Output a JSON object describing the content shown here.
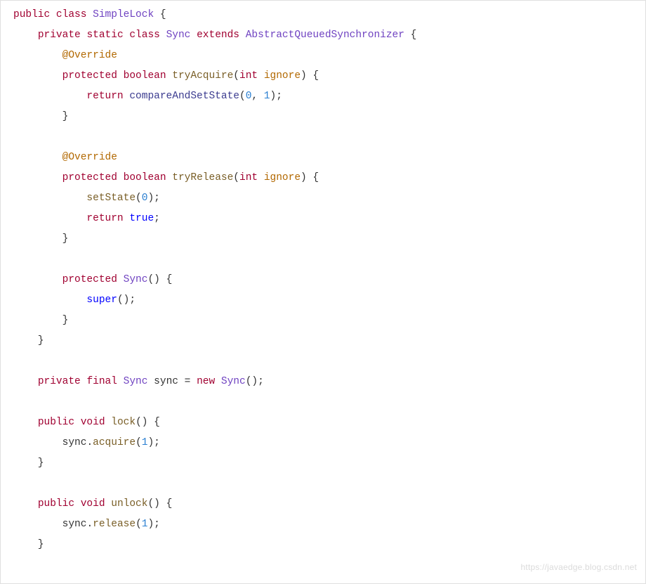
{
  "watermark": "https://javaedge.blog.csdn.net",
  "kw": {
    "public": "public",
    "class": "class",
    "private": "private",
    "static": "static",
    "extends": "extends",
    "protected": "protected",
    "boolean": "boolean",
    "return": "return",
    "final": "final",
    "new": "new",
    "void": "void"
  },
  "type": {
    "SimpleLock": "SimpleLock",
    "Sync": "Sync",
    "AbstractQueuedSynchronizer": "AbstractQueuedSynchronizer",
    "int": "int"
  },
  "ann": {
    "Override": "@Override"
  },
  "mth": {
    "tryAcquire": "tryAcquire",
    "tryRelease": "tryRelease",
    "setState": "setState",
    "lock": "lock",
    "unlock": "unlock",
    "acquire": "acquire",
    "release": "release",
    "compareAndSetState": "compareAndSetState"
  },
  "id": {
    "ignore": "ignore",
    "sync": "sync"
  },
  "num": {
    "0": "0",
    "1": "1"
  },
  "lit": {
    "true": "true",
    "super": "super"
  }
}
